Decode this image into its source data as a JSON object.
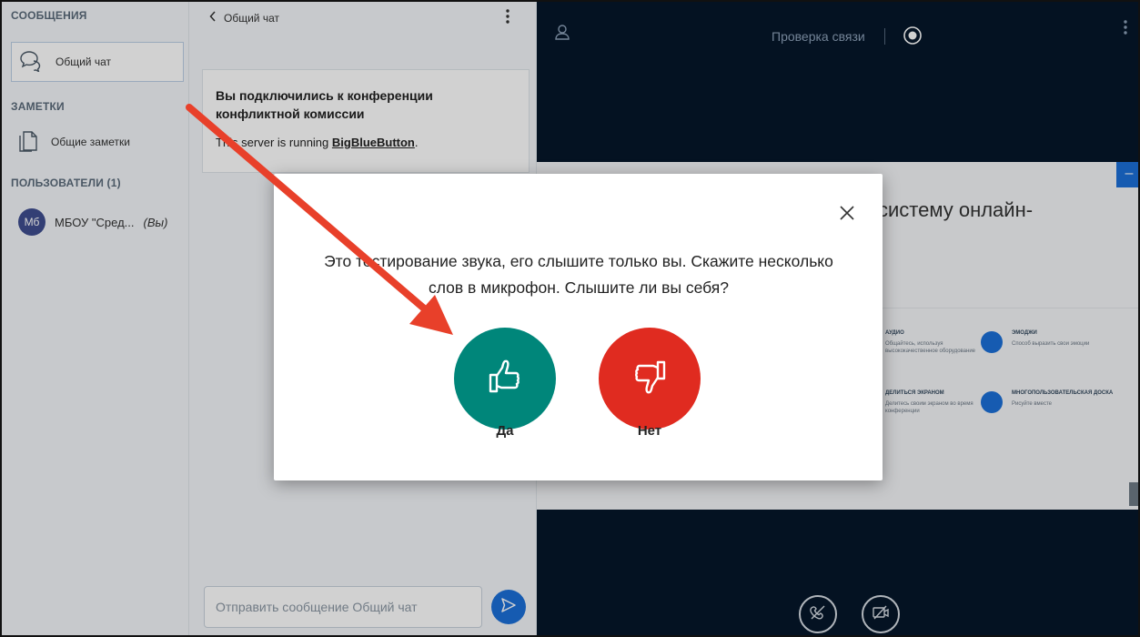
{
  "sidebar": {
    "messages_title": "СООБЩЕНИЯ",
    "public_chat_label": "Общий чат",
    "notes_title": "ЗАМЕТКИ",
    "shared_notes_label": "Общие заметки",
    "users_title": "ПОЛЬЗОВАТЕЛИ (1)",
    "user": {
      "initials": "Мб",
      "name": "МБОУ \"Сред...",
      "you_tag": "(Вы)"
    }
  },
  "chat": {
    "header": "Общий чат",
    "welcome_title": "Вы подключились к конференции конфликтной комиссии",
    "welcome_prefix": "This server is running ",
    "welcome_link": "BigBlueButton",
    "welcome_suffix": ".",
    "input_placeholder": "Отправить сообщение Общий чат"
  },
  "main": {
    "echo_test_title": "Проверка связи",
    "slide_title": "систему онлайн-",
    "features": [
      {
        "title": "АУДИО",
        "text": "Общайтесь, используя высококачественное оборудование"
      },
      {
        "title": "ЭМОДЖИ",
        "text": "Способ выразить свои эмоции"
      },
      {
        "title": "ДЕЛИТЬСЯ ЭКРАНОМ",
        "text": "Делитесь своим экраном во время конференции"
      },
      {
        "title": "МНОГОПОЛЬЗОВАТЕЛЬСКАЯ ДОСКА",
        "text": "Рисуйте вместе"
      }
    ],
    "slide_minimize": "–"
  },
  "modal": {
    "text": "Это тестирование звука, его слышите только вы. Скажите несколько слов в микрофон. Слышите ли вы себя?",
    "yes_label": "Да",
    "no_label": "Нет"
  },
  "colors": {
    "yes": "#00867a",
    "no": "#e02b20",
    "arrow": "#e8402a",
    "main_bg": "#06172a",
    "accent": "#1b6fd8"
  },
  "icons": [
    "chat-bubble-icon",
    "notes-icon",
    "back-chevron-icon",
    "kebab-menu-icon",
    "user-icon",
    "record-icon",
    "send-icon",
    "close-icon",
    "thumbs-up-icon",
    "thumbs-down-icon",
    "mute-microphone-icon",
    "camera-off-icon"
  ]
}
